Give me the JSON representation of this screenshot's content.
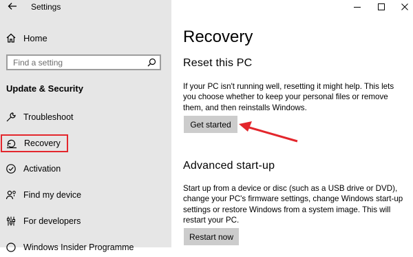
{
  "window": {
    "title": "Settings"
  },
  "sidebar": {
    "home_label": "Home",
    "search_placeholder": "Find a setting",
    "section_title": "Update & Security",
    "items": [
      {
        "label": "Troubleshoot",
        "icon": "wrench-icon"
      },
      {
        "label": "Recovery",
        "icon": "recovery-icon",
        "selected": true
      },
      {
        "label": "Activation",
        "icon": "check-circle-icon"
      },
      {
        "label": "Find my device",
        "icon": "person-location-icon"
      },
      {
        "label": "For developers",
        "icon": "developer-sliders-icon"
      },
      {
        "label": "Windows Insider Programme",
        "icon": "insider-icon"
      }
    ]
  },
  "main": {
    "title": "Recovery",
    "reset": {
      "heading": "Reset this PC",
      "description": "If your PC isn't running well, resetting it might help. This lets you choose whether to keep your personal files or remove them, and then reinstalls Windows.",
      "button": "Get started"
    },
    "advanced": {
      "heading": "Advanced start-up",
      "description": "Start up from a device or disc (such as a USB drive or DVD), change your PC's firmware settings, change Windows start-up settings or restore Windows from a system image. This will restart your PC.",
      "button": "Restart now"
    }
  },
  "colors": {
    "sidebar_bg": "#e6e6e6",
    "highlight_red": "#e3262c",
    "button_gray": "#cccccc"
  }
}
